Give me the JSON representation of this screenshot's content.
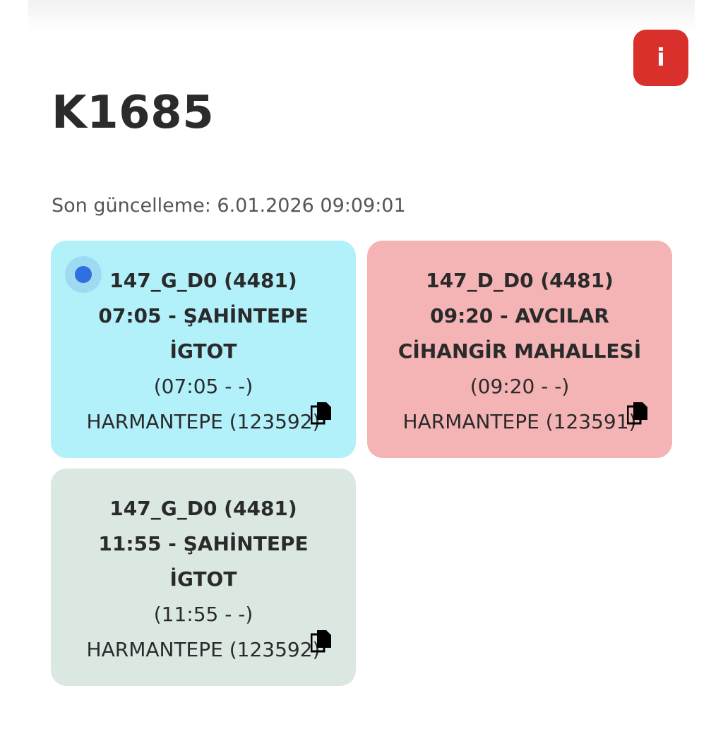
{
  "header": {
    "title": "K1685",
    "info_label": "i",
    "last_update_label": "Son güncelleme:",
    "last_update_value": "6.01.2026 09:09:01"
  },
  "colors": {
    "info_button": "#d9302c",
    "live_dot": "#2f6fe0"
  },
  "trips": [
    {
      "code": "147_G_D0 (4481)",
      "departure": "07:05 - ŞAHİNTEPE İGTOT",
      "times": "(07:05 - -)",
      "stop": "HARMANTEPE (123592)",
      "background": "#b2f0fa",
      "active": true,
      "icon": "copy-icon"
    },
    {
      "code": "147_D_D0 (4481)",
      "departure": "09:20 - AVCILAR CİHANGİR MAHALLESİ",
      "times": "(09:20 - -)",
      "stop": "HARMANTEPE (123591)",
      "background": "#f4b3b5",
      "active": false,
      "icon": "copy-icon"
    },
    {
      "code": "147_G_D0 (4481)",
      "departure": "11:55 - ŞAHİNTEPE İGTOT",
      "times": "(11:55 - -)",
      "stop": "HARMANTEPE (123592)",
      "background": "#dbe8e1",
      "active": false,
      "icon": "copy-icon"
    }
  ]
}
